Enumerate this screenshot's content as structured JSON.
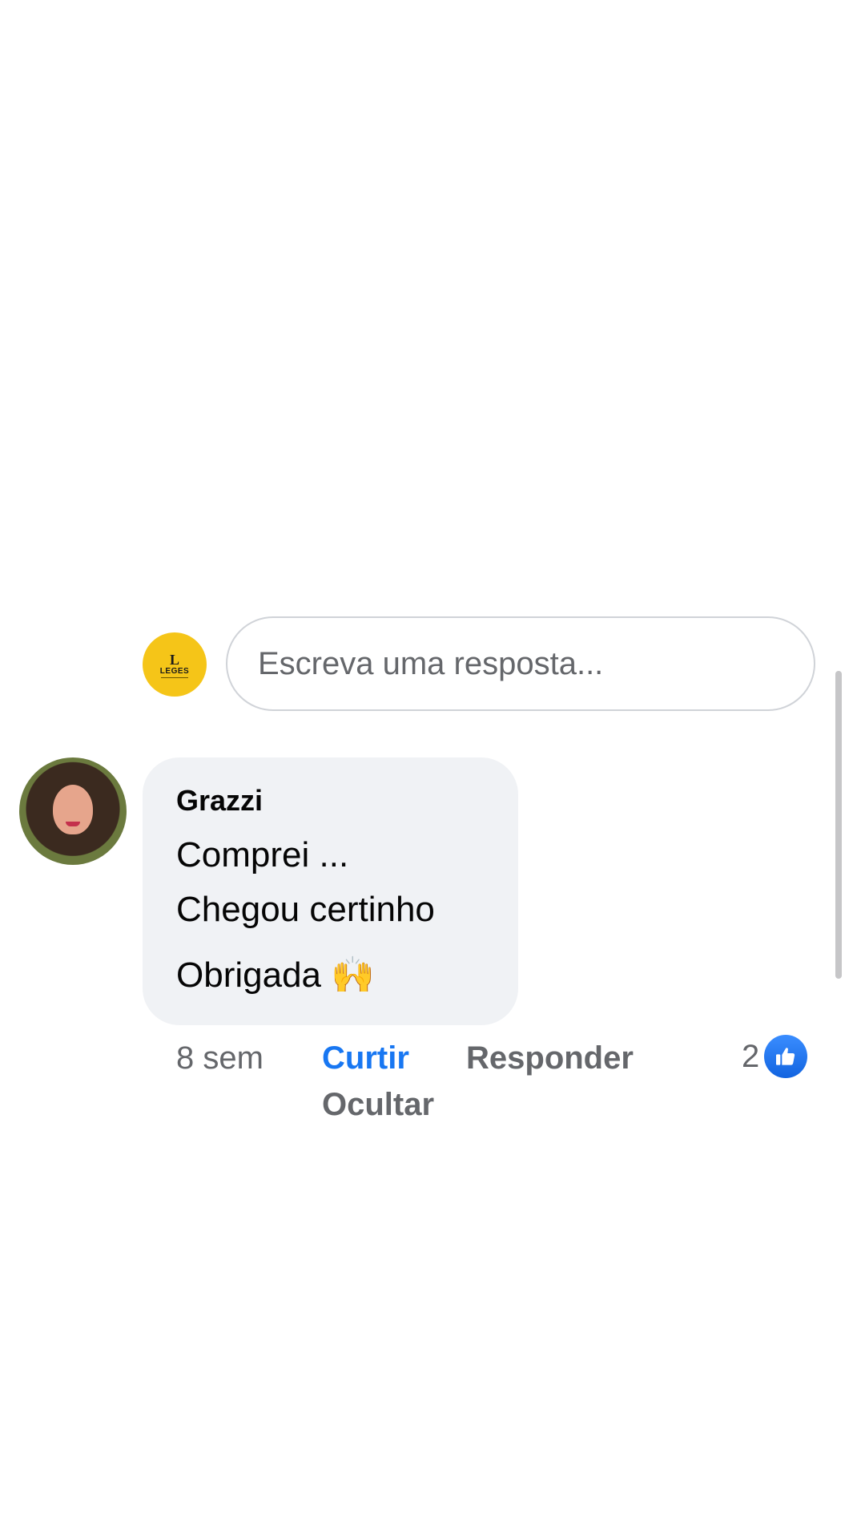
{
  "composer": {
    "avatar": {
      "brand_mark": "L",
      "brand_word": "LEGES"
    },
    "placeholder": "Escreva uma resposta..."
  },
  "comment": {
    "author": "Grazzi",
    "lines": [
      "Comprei ...",
      "Chegou certinho",
      "Obrigada"
    ],
    "emoji": "🙌",
    "time": "8 sem",
    "actions": {
      "like": "Curtir",
      "reply": "Responder",
      "hide": "Ocultar"
    },
    "reactions": {
      "count": "2",
      "icon": "thumbs-up-icon"
    }
  },
  "colors": {
    "accent": "#1877f2",
    "bubble": "#f0f2f5",
    "muted_text": "#65676b",
    "brand_yellow": "#f5c518"
  }
}
